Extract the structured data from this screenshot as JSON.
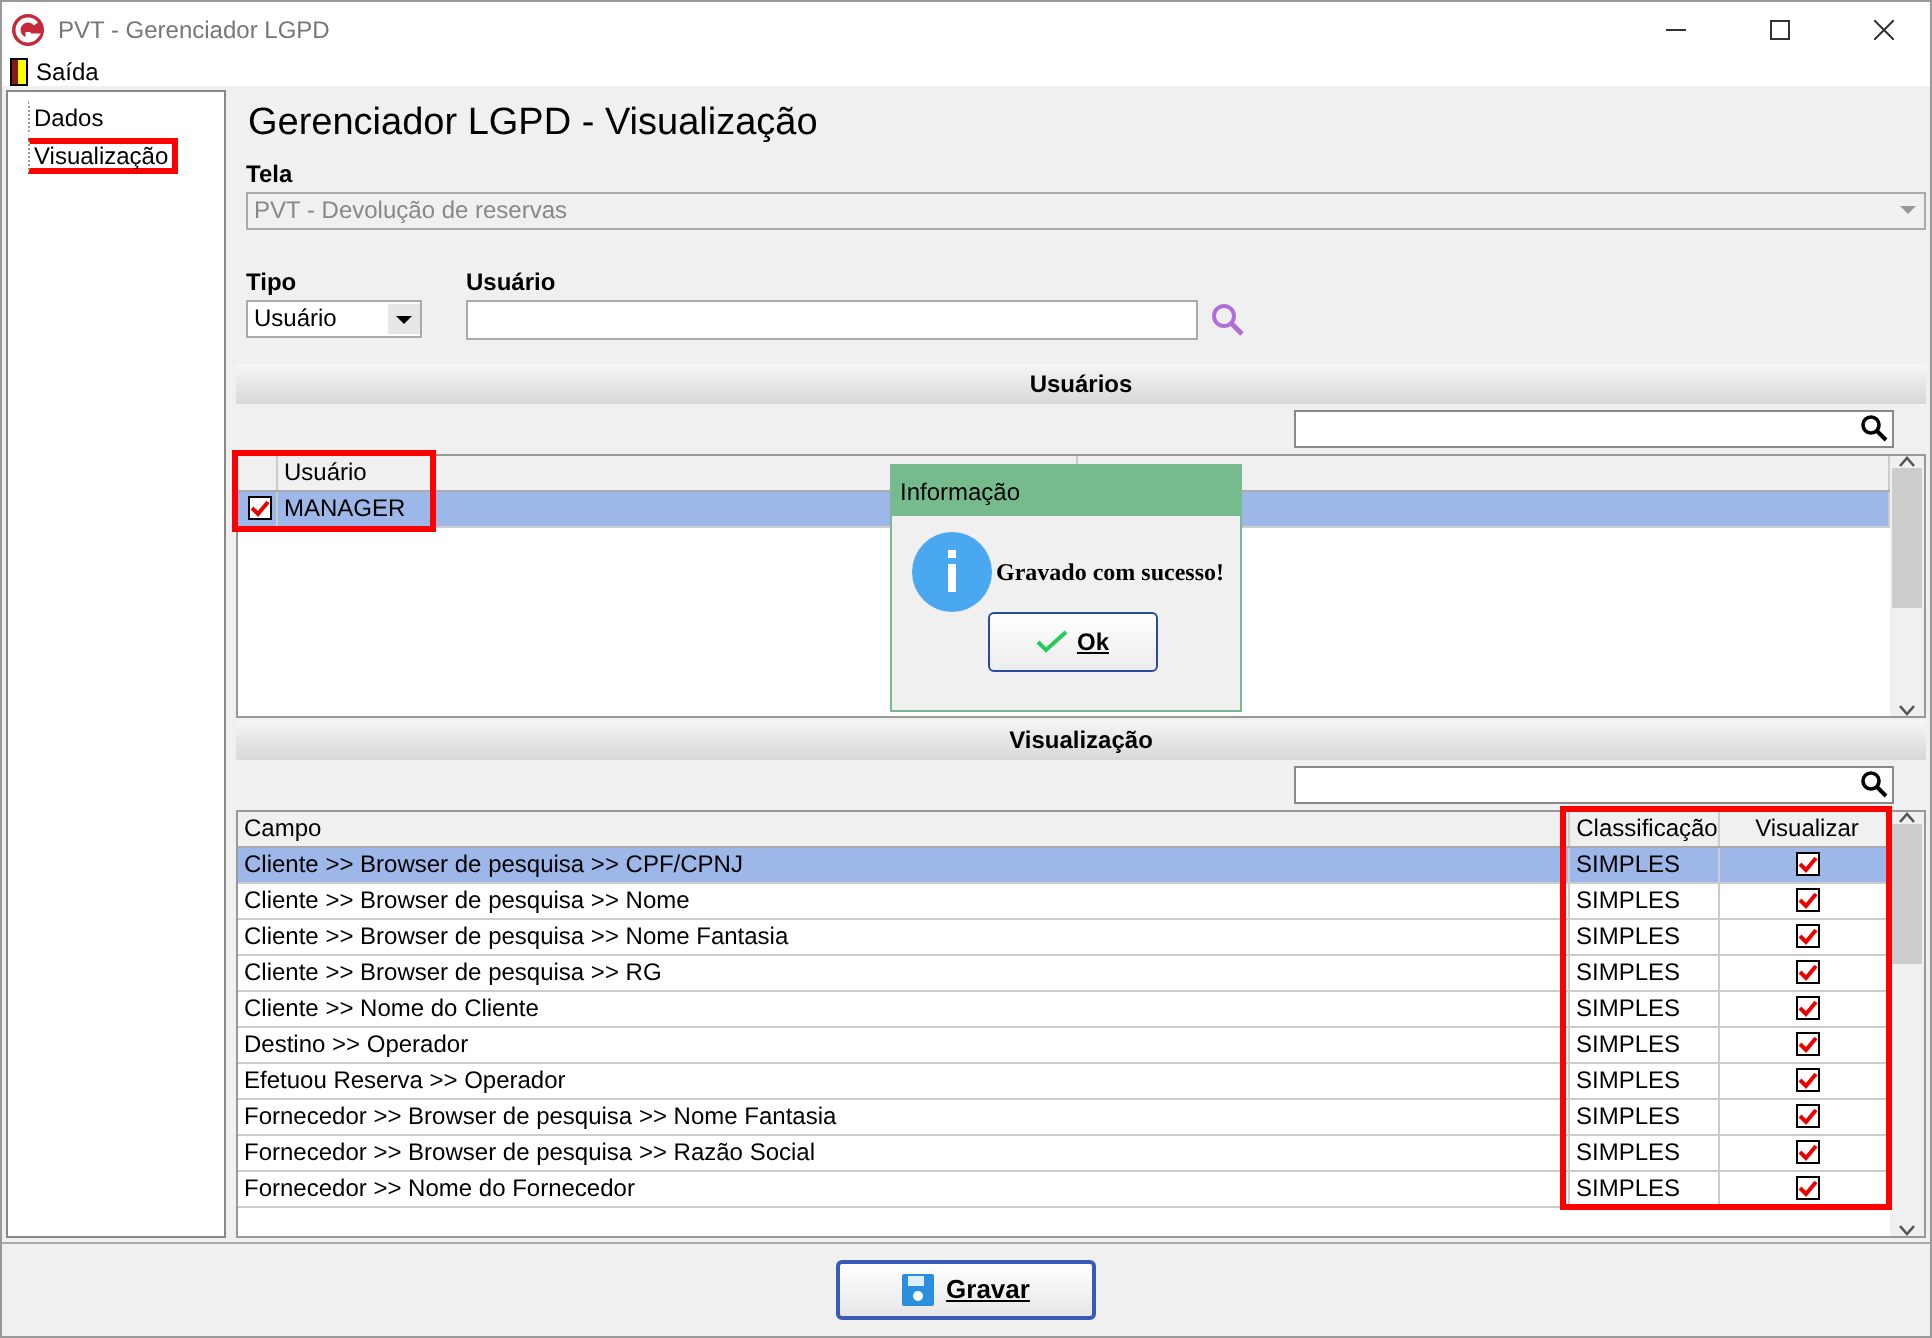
{
  "window": {
    "title": "PVT - Gerenciador LGPD"
  },
  "menu": [
    {
      "label": "Saída"
    }
  ],
  "sidebar": {
    "items": [
      {
        "label": "Dados",
        "selected": false,
        "highlighted": false
      },
      {
        "label": "Visualização",
        "selected": false,
        "highlighted": true
      }
    ]
  },
  "page_title": "Gerenciador LGPD - Visualização",
  "tela": {
    "label": "Tela",
    "value": "PVT - Devolução de reservas"
  },
  "tipo": {
    "label": "Tipo",
    "value": "Usuário"
  },
  "usuario": {
    "label": "Usuário"
  },
  "users_section": {
    "title": "Usuários",
    "highlighted": true,
    "columns": [
      "Usuário"
    ],
    "rows": [
      {
        "name": "MANAGER",
        "checked": true,
        "selected": true
      }
    ]
  },
  "fields_section": {
    "title": "Visualização",
    "highlighted": true,
    "columns": [
      "Campo",
      "Classificação",
      "Visualizar"
    ],
    "rows": [
      {
        "campo": "Cliente >> Browser de pesquisa >> CPF/CPNJ",
        "classificacao": "SIMPLES",
        "checked": true,
        "selected": true
      },
      {
        "campo": "Cliente >> Browser de pesquisa >> Nome",
        "classificacao": "SIMPLES",
        "checked": true,
        "selected": false
      },
      {
        "campo": "Cliente >> Browser de pesquisa >> Nome Fantasia",
        "classificacao": "SIMPLES",
        "checked": true,
        "selected": false
      },
      {
        "campo": "Cliente >> Browser de pesquisa >> RG",
        "classificacao": "SIMPLES",
        "checked": true,
        "selected": false
      },
      {
        "campo": "Cliente >> Nome do Cliente",
        "classificacao": "SIMPLES",
        "checked": true,
        "selected": false
      },
      {
        "campo": "Destino >> Operador",
        "classificacao": "SIMPLES",
        "checked": true,
        "selected": false
      },
      {
        "campo": "Efetuou Reserva >> Operador",
        "classificacao": "SIMPLES",
        "checked": true,
        "selected": false
      },
      {
        "campo": "Fornecedor >> Browser de pesquisa >> Nome Fantasia",
        "classificacao": "SIMPLES",
        "checked": true,
        "selected": false
      },
      {
        "campo": "Fornecedor >> Browser de pesquisa >> Razão Social",
        "classificacao": "SIMPLES",
        "checked": true,
        "selected": false
      },
      {
        "campo": "Fornecedor >> Nome do Fornecedor",
        "classificacao": "SIMPLES",
        "checked": true,
        "selected": false
      }
    ]
  },
  "save_button": {
    "label": "Gravar"
  },
  "dialog": {
    "title": "Informação",
    "message": "Gravado com sucesso!",
    "button": "Ok"
  }
}
